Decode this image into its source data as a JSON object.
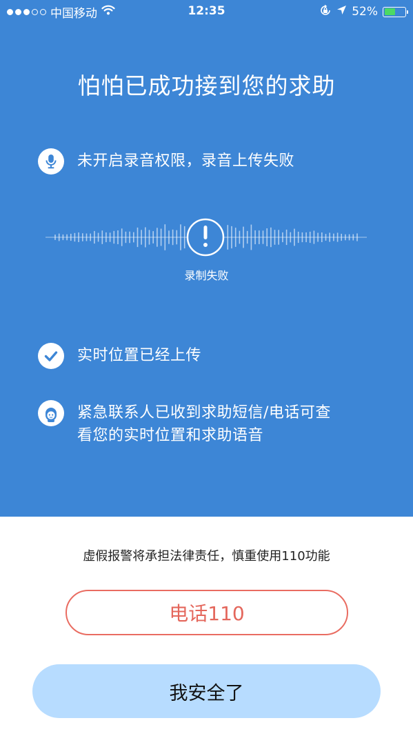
{
  "status_bar": {
    "carrier": "中国移动",
    "time": "12:35",
    "battery_percent": "52%",
    "battery_level": 0.52,
    "signal_bars_filled": 3,
    "signal_bars_total": 5
  },
  "header": {
    "title": "怕怕已成功接到您的求助"
  },
  "recording": {
    "status_text": "未开启录音权限，录音上传失败",
    "fail_label": "录制失败",
    "icon": "microphone-icon"
  },
  "location": {
    "status_text": "实时位置已经上传",
    "icon": "check-circle-icon"
  },
  "contacts": {
    "line1": "紧急联系人已收到求助短信/电话可查",
    "line2": "看您的实时位置和求助语音",
    "icon": "contact-avatar-icon"
  },
  "footer": {
    "warning": "虚假报警将承担法律责任，慎重使用110功能",
    "call_label": "电话110",
    "safe_label": "我安全了"
  },
  "colors": {
    "primary_blue": "#3d86d6",
    "call_red": "#e4675c",
    "safe_blue": "#b7dcff"
  }
}
